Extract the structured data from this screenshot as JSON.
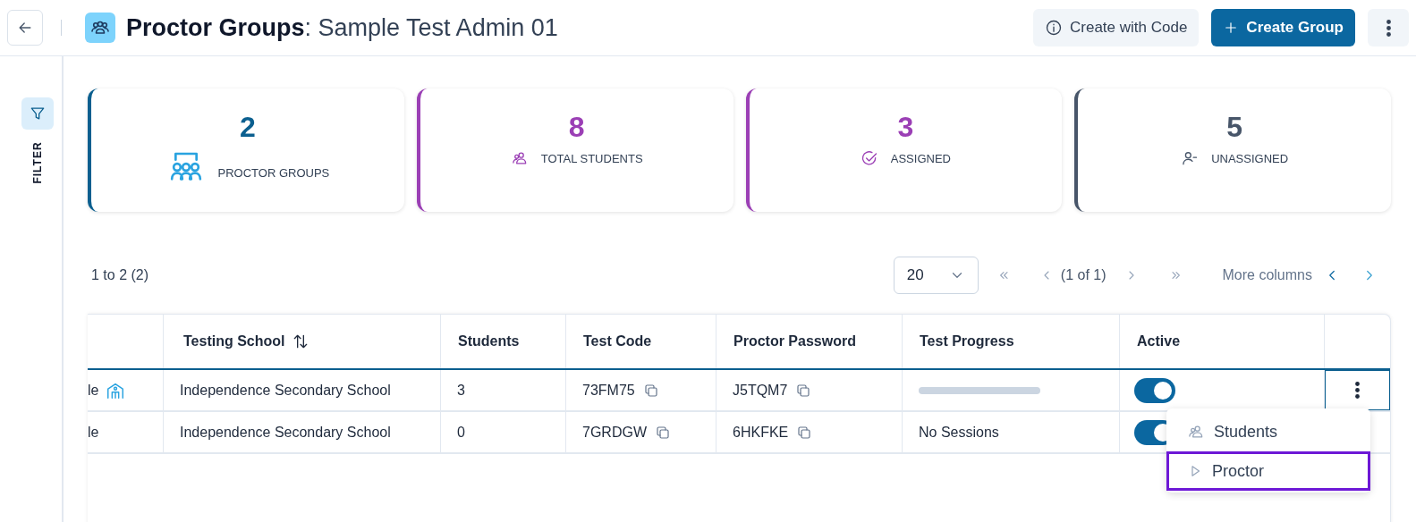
{
  "header": {
    "title_bold": "Proctor Groups",
    "title_rest": ": Sample Test Admin 01",
    "buttons": [
      {
        "label": "Create with Code",
        "kind": "secondary"
      },
      {
        "label": "Create Group",
        "kind": "primary"
      }
    ]
  },
  "filter": {
    "label": "FILTER"
  },
  "stats": [
    {
      "value": "2",
      "label": "PROCTOR GROUPS",
      "kind": "groups",
      "color": "#0b5f8f"
    },
    {
      "value": "8",
      "label": "TOTAL STUDENTS",
      "kind": "students",
      "color": "#9b3fb5"
    },
    {
      "value": "3",
      "label": "ASSIGNED",
      "kind": "assigned",
      "color": "#9b3fb5"
    },
    {
      "value": "5",
      "label": "UNASSIGNED",
      "kind": "unassigned",
      "color": "#475569"
    }
  ],
  "pagination": {
    "range": "1 to 2 (2)",
    "page_size": "20",
    "page": "(1 of 1)",
    "more_columns": "More columns"
  },
  "table": {
    "columns": [
      {
        "label": "Testing School",
        "sortable": true
      },
      {
        "label": "Students",
        "sortable": false
      },
      {
        "label": "Test Code",
        "sortable": false
      },
      {
        "label": "Proctor Password",
        "sortable": false
      },
      {
        "label": "Test Progress",
        "sortable": false
      },
      {
        "label": "Active",
        "sortable": false
      }
    ],
    "rows": [
      {
        "name": "le",
        "school_icon": true,
        "school": "Independence Secondary School",
        "students": "3",
        "test_code": "73FM75",
        "password": "J5TQM7",
        "progress": {
          "kind": "bar"
        },
        "active": true,
        "menu_open": true
      },
      {
        "name": "le",
        "school_icon": false,
        "school": "Independence Secondary School",
        "students": "0",
        "test_code": "7GRDGW",
        "password": "6HKFKE",
        "progress": {
          "kind": "text",
          "text": "No Sessions"
        },
        "active": true
      }
    ]
  },
  "menu": {
    "items": [
      {
        "label": "Students",
        "kind": "students",
        "selected": false
      },
      {
        "label": "Proctor",
        "kind": "proctor",
        "selected": true
      }
    ]
  }
}
